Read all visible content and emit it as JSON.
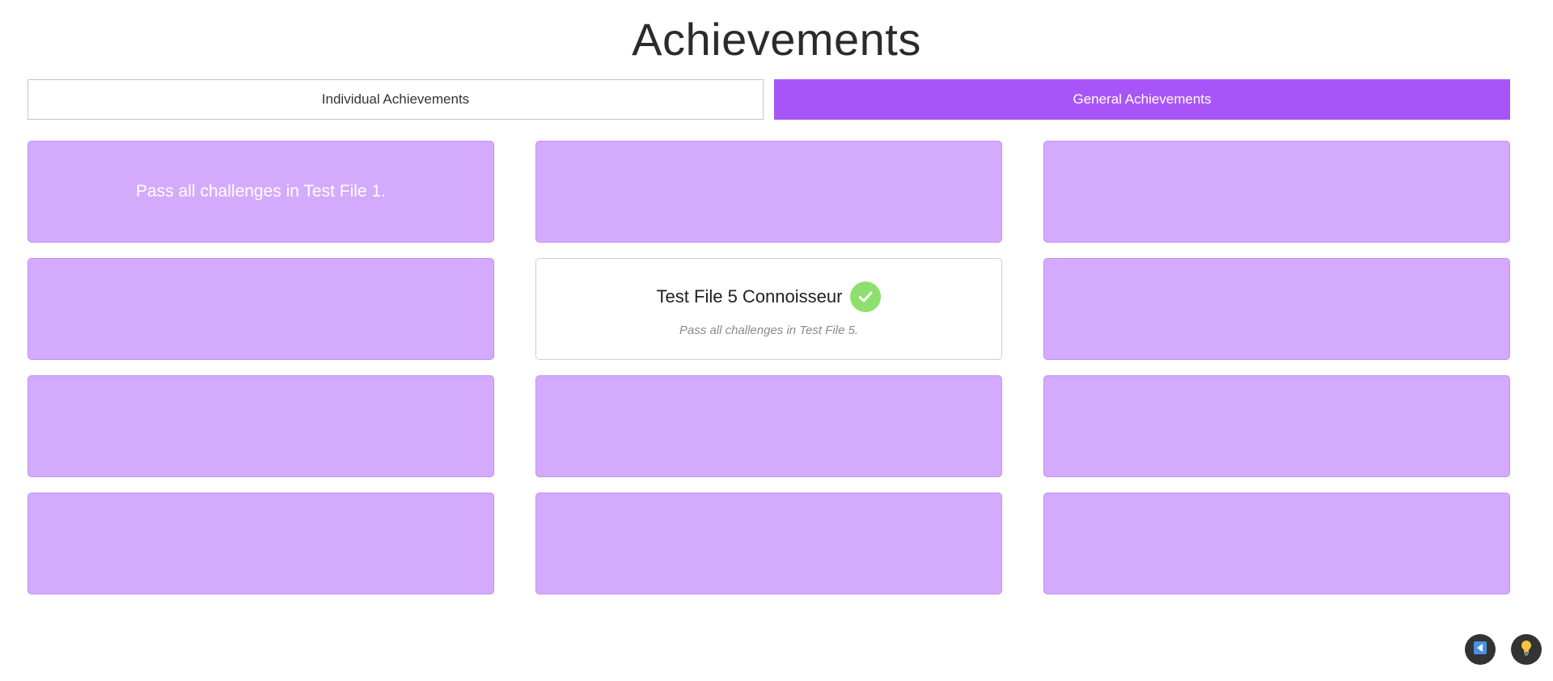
{
  "page": {
    "title": "Achievements"
  },
  "tabs": [
    {
      "label": "Individual Achievements",
      "active": false
    },
    {
      "label": "General Achievements",
      "active": true
    }
  ],
  "colors": {
    "accent": "#a855f7",
    "locked_card": "#d4aafd",
    "check": "#8ee06c"
  },
  "cards": [
    {
      "state": "locked",
      "hint": "Pass all challenges in Test File 1."
    },
    {
      "state": "locked",
      "hint": ""
    },
    {
      "state": "locked",
      "hint": ""
    },
    {
      "state": "locked",
      "hint": ""
    },
    {
      "state": "unlocked",
      "title": "Test File 5 Connoisseur",
      "description": "Pass all challenges in Test File 5.",
      "icon": "check-icon"
    },
    {
      "state": "locked",
      "hint": ""
    },
    {
      "state": "locked",
      "hint": ""
    },
    {
      "state": "locked",
      "hint": ""
    },
    {
      "state": "locked",
      "hint": ""
    },
    {
      "state": "locked",
      "hint": ""
    },
    {
      "state": "locked",
      "hint": ""
    },
    {
      "state": "locked",
      "hint": ""
    }
  ],
  "floating_buttons": [
    {
      "icon": "back-arrow-icon"
    },
    {
      "icon": "lightbulb-icon"
    }
  ]
}
